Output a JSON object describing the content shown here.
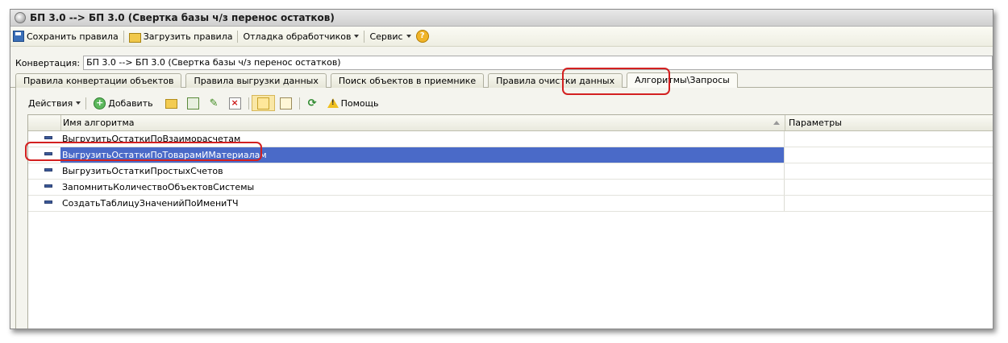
{
  "window": {
    "title": "БП 3.0 --> БП 3.0 (Свертка базы ч/з перенос остатков)"
  },
  "toolbar": {
    "save_label": "Сохранить правила",
    "load_label": "Загрузить правила",
    "debug_label": "Отладка обработчиков",
    "service_label": "Сервис",
    "help_label": "?"
  },
  "conversion": {
    "label": "Конвертация:",
    "value": "БП 3.0 --> БП 3.0 (Свертка базы ч/з перенос остатков)"
  },
  "tabs": [
    {
      "label": "Правила конвертации объектов"
    },
    {
      "label": "Правила выгрузки данных"
    },
    {
      "label": "Поиск объектов в приемнике"
    },
    {
      "label": "Правила очистки данных"
    },
    {
      "label": "Алгоритмы\\Запросы"
    }
  ],
  "actions": {
    "actions_label": "Действия",
    "add_label": "Добавить",
    "refresh_label": "",
    "help_label": "Помощь"
  },
  "table": {
    "columns": [
      "Имя алгоритма",
      "Параметры"
    ],
    "rows": [
      {
        "name": "ВыгрузитьОстаткиПоВзаиморасчетам",
        "params": ""
      },
      {
        "name": "ВыгрузитьОстаткиПоТоварамИМатериалам",
        "params": ""
      },
      {
        "name": "ВыгрузитьОстаткиПростыхСчетов",
        "params": ""
      },
      {
        "name": "ЗапомнитьКоличествоОбъектовСистемы",
        "params": ""
      },
      {
        "name": "СоздатьТаблицуЗначенийПоИмениТЧ",
        "params": ""
      }
    ],
    "selected_row": 1
  },
  "colors": {
    "selection": "#4a6ac8",
    "highlight_oval": "#d32020"
  },
  "icons": {
    "titlebar": "app-icon",
    "save": "save-icon",
    "load": "folder-open-icon",
    "help": "help-icon",
    "add": "add-icon",
    "row": "algorithm-row-icon"
  }
}
